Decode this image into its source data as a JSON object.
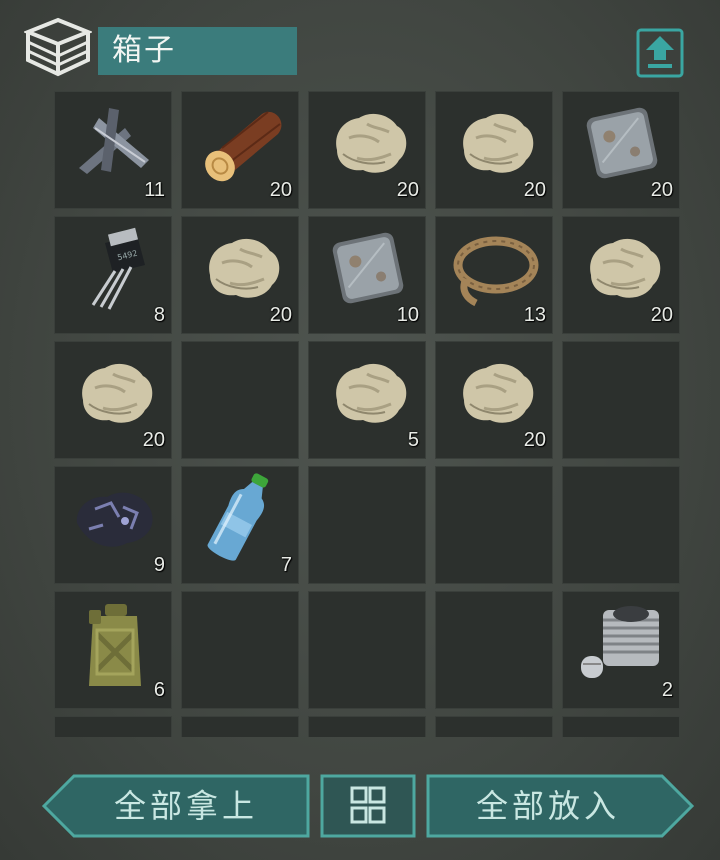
{
  "container": {
    "title": "箱子"
  },
  "slots": [
    {
      "item": "scrap-metal",
      "count": "11"
    },
    {
      "item": "log",
      "count": "20"
    },
    {
      "item": "stone",
      "count": "20"
    },
    {
      "item": "stone",
      "count": "20"
    },
    {
      "item": "iron-plate",
      "count": "20"
    },
    {
      "item": "transistor",
      "count": "8"
    },
    {
      "item": "stone",
      "count": "20"
    },
    {
      "item": "iron-plate",
      "count": "10"
    },
    {
      "item": "rope",
      "count": "13"
    },
    {
      "item": "stone",
      "count": "20"
    },
    {
      "item": "stone",
      "count": "20"
    },
    {
      "item": "",
      "count": ""
    },
    {
      "item": "stone",
      "count": "5"
    },
    {
      "item": "stone",
      "count": "20"
    },
    {
      "item": "",
      "count": ""
    },
    {
      "item": "coal-ore",
      "count": "9"
    },
    {
      "item": "water-bottle",
      "count": "7"
    },
    {
      "item": "",
      "count": ""
    },
    {
      "item": "",
      "count": ""
    },
    {
      "item": "",
      "count": ""
    },
    {
      "item": "jerrycan",
      "count": "6"
    },
    {
      "item": "",
      "count": ""
    },
    {
      "item": "",
      "count": ""
    },
    {
      "item": "",
      "count": ""
    },
    {
      "item": "engine-cylinder",
      "count": "2"
    },
    {
      "item": "",
      "count": ""
    },
    {
      "item": "",
      "count": ""
    },
    {
      "item": "",
      "count": ""
    },
    {
      "item": "",
      "count": ""
    },
    {
      "item": "",
      "count": ""
    }
  ],
  "actions": {
    "take_all_label": "全部拿上",
    "put_all_label": "全部放入",
    "sort_icon": "grid-sort-icon"
  },
  "colors": {
    "accent": "#3b7c7c",
    "button_fill": "#2f6664",
    "button_border": "#4ea8a0",
    "slot_bg": "#2c302d"
  }
}
